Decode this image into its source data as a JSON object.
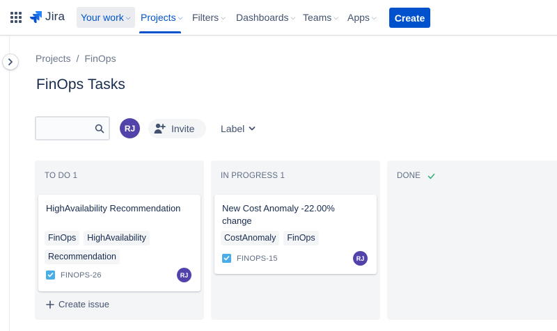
{
  "nav": {
    "logo_text": "Jira",
    "items": [
      {
        "label": "Your work"
      },
      {
        "label": "Projects"
      },
      {
        "label": "Filters"
      },
      {
        "label": "Dashboards"
      },
      {
        "label": "Teams"
      },
      {
        "label": "Apps"
      }
    ],
    "create_label": "Create"
  },
  "breadcrumb": {
    "items": [
      "Projects",
      "FinOps"
    ],
    "separator": "/"
  },
  "page": {
    "title": "FinOps Tasks"
  },
  "toolbar": {
    "search_value": "",
    "search_placeholder": "",
    "avatar_initials": "RJ",
    "invite_label": "Invite",
    "label_filter": "Label"
  },
  "board": {
    "columns": [
      {
        "title": "TO DO 1",
        "cards": [
          {
            "title": "HighAvailability Recommendation",
            "labels": [
              "FinOps",
              "HighAvailability",
              "Recommendation"
            ],
            "key": "FINOPS-26",
            "assignee": "RJ"
          }
        ],
        "create_issue_label": "Create issue"
      },
      {
        "title": "IN PROGRESS 1",
        "cards": [
          {
            "title": "New Cost Anomaly -22.00% change",
            "labels": [
              "CostAnomaly",
              "FinOps"
            ],
            "key": "FINOPS-15",
            "assignee": "RJ"
          }
        ]
      },
      {
        "title": "DONE",
        "cards": []
      }
    ]
  },
  "colors": {
    "brand": "#0052cc",
    "avatar": "#5243aa",
    "task_icon": "#4bade8",
    "column_bg": "#f4f5f7"
  },
  "icons": {
    "app_switcher": "grid-icon",
    "logo": "jira-logo-icon",
    "search": "search-icon",
    "invite": "add-person-icon",
    "done": "checkmark-icon",
    "task": "task-checkbox-icon",
    "create": "plus-icon",
    "expand": "chevron-right-icon"
  }
}
